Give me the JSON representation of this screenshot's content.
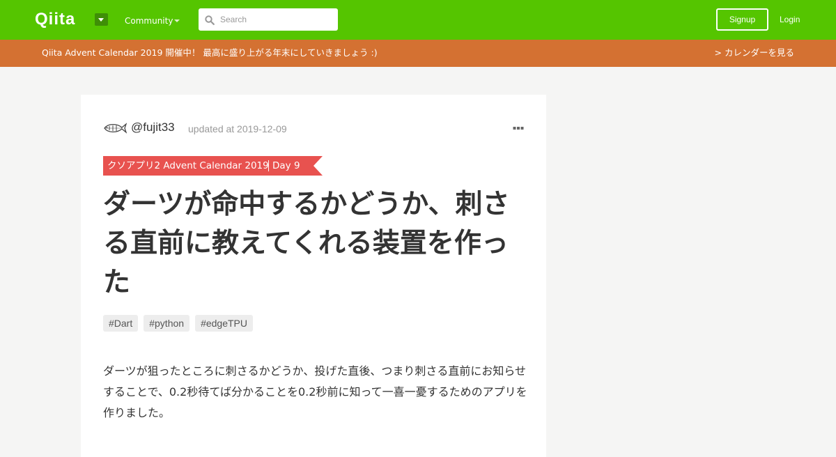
{
  "header": {
    "logo": "Qiita",
    "community_label": "Community",
    "search_placeholder": "Search",
    "signup_label": "Signup",
    "login_label": "Login"
  },
  "banner": {
    "text": "Qiita Advent Calendar 2019 開催中！ 最高に盛り上がる年末にしていきましょう :)",
    "link_label": "> カレンダーを見る"
  },
  "article": {
    "author": "@fujit33",
    "updated": "updated at 2019-12-09",
    "calendar_name": "クソアプリ2 Advent Calendar 2019",
    "calendar_day": "Day 9",
    "title": "ダーツが命中するかどうか、刺さる直前に教えてくれる装置を作った",
    "tags": [
      "#Dart",
      "#python",
      "#edgeTPU"
    ],
    "body": "ダーツが狙ったところに刺さるかどうか、投げた直後、つまり刺さる直前にお知らせすることで、0.2秒待てば分かることを0.2秒前に知って一喜一憂するためのアプリを作りました。"
  },
  "icons": {
    "logo_dropdown": "chevron-down-icon",
    "search": "search-icon",
    "more": "more-horizontal-icon",
    "avatar": "fish-icon"
  },
  "colors": {
    "header_bg": "#55c500",
    "banner_bg": "#d47132",
    "ribbon_bg": "#e8524f",
    "page_bg": "#f5f5f4"
  }
}
